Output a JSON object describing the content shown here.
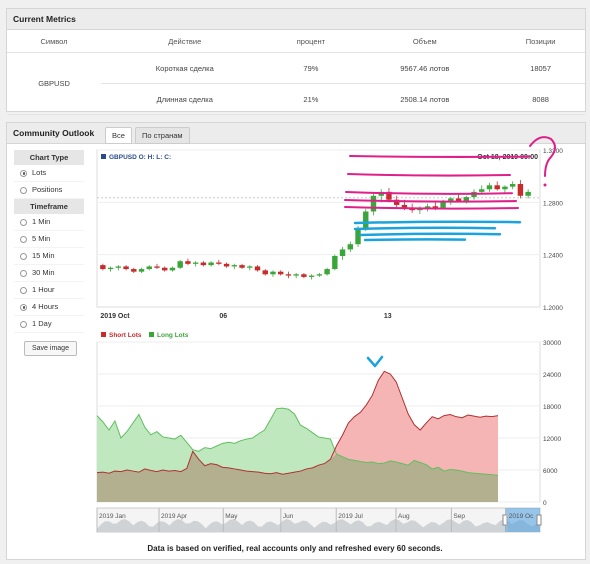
{
  "metrics": {
    "title": "Current Metrics",
    "headers": [
      "Символ",
      "Действие",
      "процент",
      "Объем",
      "Позиции"
    ],
    "symbol": "GBPUSD",
    "rows": [
      {
        "action": "Короткая сделка",
        "percent": "79%",
        "volume": "9567.46 лотов",
        "positions": "18057"
      },
      {
        "action": "Длинная сделка",
        "percent": "21%",
        "volume": "2508.14 лотов",
        "positions": "8088"
      }
    ]
  },
  "outlook": {
    "title": "Community Outlook",
    "tabs": [
      "Все",
      "По странам"
    ],
    "chart_type_label": "Chart Type",
    "chart_types": [
      "Lots",
      "Positions"
    ],
    "selected_chart_type": "Lots",
    "timeframe_label": "Timeframe",
    "timeframes": [
      "1 Min",
      "5 Min",
      "15 Min",
      "30 Min",
      "1 Hour",
      "4 Hours",
      "1 Day"
    ],
    "selected_timeframe": "4 Hours",
    "save_label": "Save image"
  },
  "footer": "Data is based on verified, real accounts only and refreshed every 60 seconds.",
  "colors": {
    "up": "#3aa63a",
    "down": "#c92a2a",
    "short_fill": "#f5b5b5",
    "long_fill": "#bfe8bf",
    "overlap_fill": "#b3b090",
    "short_line": "#b03030",
    "long_line": "#5fbf5f",
    "annot_pink": "#e0208a",
    "annot_blue": "#1aa3dd",
    "navigator": "#4a9fe0"
  },
  "chart_data": [
    {
      "type": "candlestick",
      "title": "GBPUSD O: H: L: C:",
      "timestamp_label": "Oct 18, 2019 09:00",
      "x_ticks": [
        "2019 Oct",
        "06",
        "13"
      ],
      "y_ticks": [
        "1.2000",
        "1.2400",
        "1.2800",
        "1.3200"
      ],
      "ylim": [
        1.2,
        1.32
      ],
      "current_price": 1.2835,
      "candles": [
        [
          1.232,
          1.233,
          1.228,
          1.229
        ],
        [
          1.229,
          1.231,
          1.227,
          1.23
        ],
        [
          1.23,
          1.232,
          1.228,
          1.231
        ],
        [
          1.231,
          1.232,
          1.228,
          1.229
        ],
        [
          1.229,
          1.23,
          1.226,
          1.227
        ],
        [
          1.227,
          1.23,
          1.226,
          1.229
        ],
        [
          1.229,
          1.232,
          1.228,
          1.231
        ],
        [
          1.231,
          1.233,
          1.229,
          1.23
        ],
        [
          1.23,
          1.231,
          1.227,
          1.228
        ],
        [
          1.228,
          1.231,
          1.227,
          1.23
        ],
        [
          1.23,
          1.236,
          1.229,
          1.235
        ],
        [
          1.235,
          1.237,
          1.232,
          1.233
        ],
        [
          1.233,
          1.235,
          1.231,
          1.234
        ],
        [
          1.234,
          1.235,
          1.231,
          1.232
        ],
        [
          1.232,
          1.235,
          1.231,
          1.234
        ],
        [
          1.234,
          1.236,
          1.232,
          1.233
        ],
        [
          1.233,
          1.234,
          1.23,
          1.231
        ],
        [
          1.231,
          1.233,
          1.229,
          1.232
        ],
        [
          1.232,
          1.233,
          1.229,
          1.23
        ],
        [
          1.23,
          1.232,
          1.228,
          1.231
        ],
        [
          1.231,
          1.232,
          1.227,
          1.228
        ],
        [
          1.228,
          1.229,
          1.224,
          1.225
        ],
        [
          1.225,
          1.228,
          1.223,
          1.227
        ],
        [
          1.227,
          1.228,
          1.224,
          1.225
        ],
        [
          1.225,
          1.227,
          1.222,
          1.224
        ],
        [
          1.224,
          1.226,
          1.222,
          1.225
        ],
        [
          1.225,
          1.226,
          1.222,
          1.223
        ],
        [
          1.223,
          1.225,
          1.221,
          1.224
        ],
        [
          1.224,
          1.226,
          1.223,
          1.225
        ],
        [
          1.225,
          1.23,
          1.224,
          1.229
        ],
        [
          1.229,
          1.24,
          1.228,
          1.239
        ],
        [
          1.239,
          1.246,
          1.236,
          1.244
        ],
        [
          1.244,
          1.25,
          1.242,
          1.248
        ],
        [
          1.248,
          1.262,
          1.246,
          1.26
        ],
        [
          1.26,
          1.275,
          1.258,
          1.273
        ],
        [
          1.273,
          1.287,
          1.27,
          1.285
        ],
        [
          1.285,
          1.29,
          1.28,
          1.288
        ],
        [
          1.288,
          1.291,
          1.28,
          1.282
        ],
        [
          1.282,
          1.285,
          1.276,
          1.278
        ],
        [
          1.278,
          1.282,
          1.274,
          1.276
        ],
        [
          1.276,
          1.279,
          1.272,
          1.274
        ],
        [
          1.274,
          1.277,
          1.271,
          1.275
        ],
        [
          1.275,
          1.279,
          1.273,
          1.277
        ],
        [
          1.277,
          1.28,
          1.274,
          1.276
        ],
        [
          1.276,
          1.282,
          1.275,
          1.28
        ],
        [
          1.28,
          1.284,
          1.278,
          1.283
        ],
        [
          1.283,
          1.286,
          1.28,
          1.281
        ],
        [
          1.281,
          1.285,
          1.279,
          1.284
        ],
        [
          1.284,
          1.29,
          1.282,
          1.288
        ],
        [
          1.288,
          1.293,
          1.286,
          1.29
        ],
        [
          1.29,
          1.295,
          1.288,
          1.293
        ],
        [
          1.293,
          1.296,
          1.289,
          1.29
        ],
        [
          1.29,
          1.293,
          1.287,
          1.292
        ],
        [
          1.292,
          1.296,
          1.29,
          1.294
        ],
        [
          1.294,
          1.297,
          1.283,
          1.285
        ],
        [
          1.285,
          1.29,
          1.283,
          1.288
        ]
      ]
    },
    {
      "type": "area",
      "legend": [
        "Short Lots",
        "Long Lots"
      ],
      "y_ticks": [
        "0",
        "6000",
        "12000",
        "18000",
        "24000",
        "30000"
      ],
      "ylim": [
        0,
        30000
      ],
      "x_ticks": [
        "2019 Jan",
        "2019 Apr",
        "May",
        "Jun",
        "2019 Jul",
        "Aug",
        "Sep",
        "2019 Oc"
      ],
      "series": [
        {
          "name": "Short Lots",
          "values": [
            5500,
            5600,
            5400,
            5800,
            5700,
            6000,
            5800,
            5600,
            6200,
            5900,
            5700,
            6000,
            5800,
            5900,
            5700,
            6300,
            9500,
            8000,
            6800,
            7200,
            7000,
            6500,
            6400,
            6200,
            6000,
            5800,
            5700,
            5600,
            5400,
            5300,
            5500,
            5200,
            5400,
            5600,
            5800,
            6200,
            6400,
            6900,
            7200,
            8000,
            10500,
            12500,
            14800,
            16000,
            16800,
            18200,
            20000,
            22800,
            24500,
            24000,
            22500,
            19500,
            16500,
            14500,
            13500,
            14800,
            16000,
            15600,
            16200,
            16400,
            16000,
            15800,
            16300,
            16100,
            15900,
            16100,
            16000,
            16200
          ]
        },
        {
          "name": "Long Lots",
          "values": [
            16200,
            15000,
            13500,
            15200,
            12000,
            13200,
            14800,
            16400,
            14000,
            12600,
            13200,
            12200,
            12000,
            11800,
            12500,
            11200,
            9800,
            9500,
            10200,
            10000,
            10500,
            11000,
            11200,
            11000,
            11500,
            11800,
            12000,
            12800,
            13500,
            15500,
            17500,
            17600,
            17400,
            16500,
            14400,
            13800,
            13000,
            12200,
            12000,
            11800,
            9000,
            8500,
            8000,
            7800,
            7600,
            7400,
            7500,
            7200,
            7300,
            7700,
            7500,
            7200,
            6900,
            7800,
            7400,
            7000,
            6200,
            6500,
            5800,
            6100,
            6000,
            5800,
            5500,
            5400,
            5300,
            5200,
            5100,
            5000
          ]
        }
      ]
    }
  ]
}
